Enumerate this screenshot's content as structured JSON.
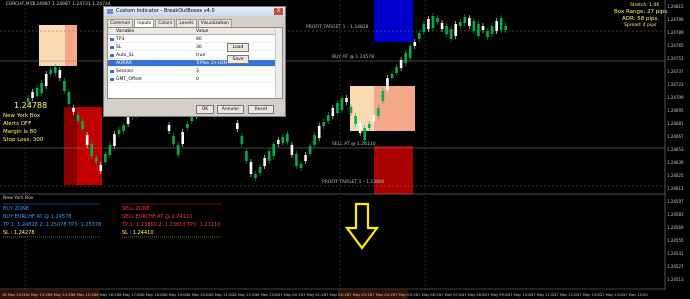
{
  "window": {
    "title": "EURCHF,M15"
  },
  "chart": {
    "price_labels": [
      "1.24815",
      "1.24799",
      "1.24789",
      "1.24765",
      "1.24751",
      "1.24737",
      "1.24723",
      "1.24709",
      "1.24695",
      "1.24681",
      "1.24667",
      "1.24653",
      "1.24639",
      "1.24625",
      "1.24611",
      "1.24597",
      "1.24583",
      "1.24569",
      "1.24555",
      "1.24541",
      "1.24527",
      "1.24513"
    ],
    "time_labels": [
      "16 May 2013",
      "16 May 13:15",
      "16 May 14:15",
      "16 May 15:15",
      "16 May 16:15",
      "16 May 17:00",
      "16 May 18:00",
      "16 May 19:00",
      "16 May 20:00",
      "16 May 21:00",
      "16 May 22:00",
      "16 May 23:00",
      "17 May 00:15",
      "17 May 01:15",
      "17 May 02:15",
      "17 May 03:15",
      "17 May 04:15",
      "17 May 05:15",
      "17 May 06:15",
      "17 May 07:00",
      "17 May 08:00",
      "17 May 09:00",
      "17 May 10:00",
      "17 May 11:00",
      "17 May 12:00",
      "17 May 13:00",
      "17 May 14:00",
      "17 May 15:00",
      "17 May 16:00"
    ],
    "bar_readout": "1.24987 1.24987 1.24731 1.24744",
    "profit_target_top": "PROFIT TARGET 1 - 1.24828",
    "buy_at": "BUY AT @ 1.24578",
    "sell_at": "SELL AT @ 1.24110",
    "profit_target_bottom": "PROFIT TARGET 1 - 1.23860",
    "big_price": "1.24788",
    "colors": {
      "buy_zone": "#f4a888",
      "buy_zone_light": "#fbd9b2",
      "sell_zone": "#c00000",
      "blue_zone": "#0000cc",
      "up_candle": "#00b050",
      "down_candle": "#ffffff",
      "text_yellow": "#ffff66",
      "text_red": "#ff3333",
      "text_blue": "#3399ff"
    }
  },
  "info_panel": {
    "lines": [
      "Stretch: 1.06",
      "Box Range: 27 pips.",
      "ADR: 58 pips.",
      "Spread: 4 pips"
    ]
  },
  "left_info": {
    "lines": [
      "New York Box",
      "Alerts OFF",
      "Margin is 80",
      "Stop Loss: 300"
    ]
  },
  "zones": {
    "title": "New York Box",
    "buy_zone": "BUY ZONE",
    "buy_line": "BUY EURCHF AT @ 1.24578",
    "buy_tp": "TP 1: 1.24828   2: 1.25078   TP3: 1.25378",
    "buy_sl": "SL : 1.24278",
    "sell_zone": "SELL ZONE",
    "sell_line": "SELL EURCHF AT @ 1.24110",
    "sell_tp": "TP 1: 1.23860   2: 1.23610   TP3: 1.23110",
    "sell_sl": "SL : 1.24410"
  },
  "dialog": {
    "title": "Custom Indicator - BreakOutBoxes v4.0",
    "close": "X",
    "tabs": [
      "Common",
      "Inputs",
      "Colors",
      "Levels",
      "Visualization"
    ],
    "col_variable": "Variable",
    "col_value": "Value",
    "rows": [
      {
        "var": "TP3",
        "val": "80"
      },
      {
        "var": "SL",
        "val": "30"
      },
      {
        "var": "Auto_SL",
        "val": "true"
      },
      {
        "var": "ADRRR",
        "val": "TrPlan 2+LON 3+RT"
      },
      {
        "var": "Session",
        "val": "3"
      },
      {
        "var": "GMT_Offset",
        "val": "0"
      }
    ],
    "buttons": {
      "load": "Load",
      "save": "Save",
      "ok": "OK",
      "cancel": "Annuler",
      "reset": "Reset"
    }
  },
  "annotations": {
    "arrow_red": "down-arrow",
    "arrow_yellow": "down-arrow"
  }
}
